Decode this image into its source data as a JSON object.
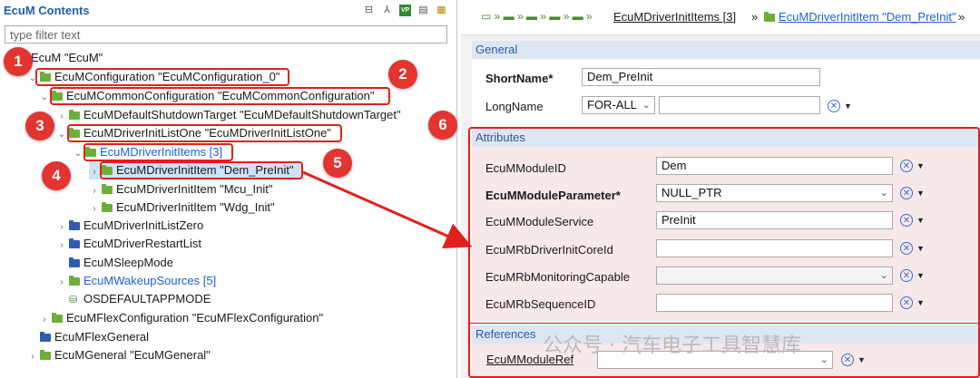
{
  "left": {
    "title": "EcuM Contents",
    "filter_placeholder": "type filter text",
    "toolbar_icons": [
      "collapse-all-icon",
      "hierarchy-icon",
      "vp-res-icon",
      "document-icon",
      "grid-icon"
    ],
    "tree": [
      {
        "label": "EcuM \"EcuM\""
      },
      {
        "label": "EcuMConfiguration \"EcuMConfiguration_0\""
      },
      {
        "label": "EcuMCommonConfiguration \"EcuMCommonConfiguration\""
      },
      {
        "label": "EcuMDefaultShutdownTarget \"EcuMDefaultShutdownTarget\""
      },
      {
        "label": "EcuMDriverInitListOne \"EcuMDriverInitListOne\""
      },
      {
        "label": "EcuMDriverInitItems [3]"
      },
      {
        "label": "EcuMDriverInitItem \"Dem_PreInit\""
      },
      {
        "label": "EcuMDriverInitItem \"Mcu_Init\""
      },
      {
        "label": "EcuMDriverInitItem \"Wdg_Init\""
      },
      {
        "label": "EcuMDriverInitListZero"
      },
      {
        "label": "EcuMDriverRestartList"
      },
      {
        "label": "EcuMSleepMode"
      },
      {
        "label": "EcuMWakeupSources [5]"
      },
      {
        "label": "OSDEFAULTAPPMODE"
      },
      {
        "label": "EcuMFlexConfiguration \"EcuMFlexConfiguration\""
      },
      {
        "label": "EcuMFlexGeneral"
      },
      {
        "label": "EcuMGeneral \"EcuMGeneral\""
      }
    ]
  },
  "badges": [
    "1",
    "2",
    "3",
    "4",
    "5",
    "6"
  ],
  "breadcrumb": {
    "items_label": "EcuMDriverInitItems [3]",
    "item_label": "EcuMDriverInitItem \"Dem_PreInit\"",
    "sep": "»"
  },
  "general": {
    "section": "General",
    "shortname_label": "ShortName*",
    "shortname_value": "Dem_PreInit",
    "longname_label": "LongName",
    "longname_lang": "FOR-ALL",
    "longname_value": ""
  },
  "attributes": {
    "section": "Attributes",
    "rows": [
      {
        "label": "EcuMModuleID",
        "value": ""
      },
      {
        "label": "EcuMModuleParameter*",
        "value": "NULL_PTR"
      },
      {
        "label": "EcuMModuleService",
        "value": "PreInit"
      },
      {
        "label": "EcuMRbDriverInitCoreId",
        "value": ""
      },
      {
        "label": "EcuMRbMonitoringCapable",
        "value": ""
      },
      {
        "label": "EcuMRbSequenceID",
        "value": ""
      }
    ],
    "module_id_value": "Dem"
  },
  "references": {
    "section": "References",
    "rows": [
      {
        "label": "EcuMModuleRef",
        "value": ""
      }
    ]
  },
  "watermark": "公众号 · 汽车电子工具智慧库",
  "colors": {
    "accent_red": "#e3342f",
    "section_blue": "#dde6f3",
    "link_blue": "#1e5fd9",
    "folder_green": "#6dae3a",
    "folder_blue": "#2f5bb4"
  }
}
